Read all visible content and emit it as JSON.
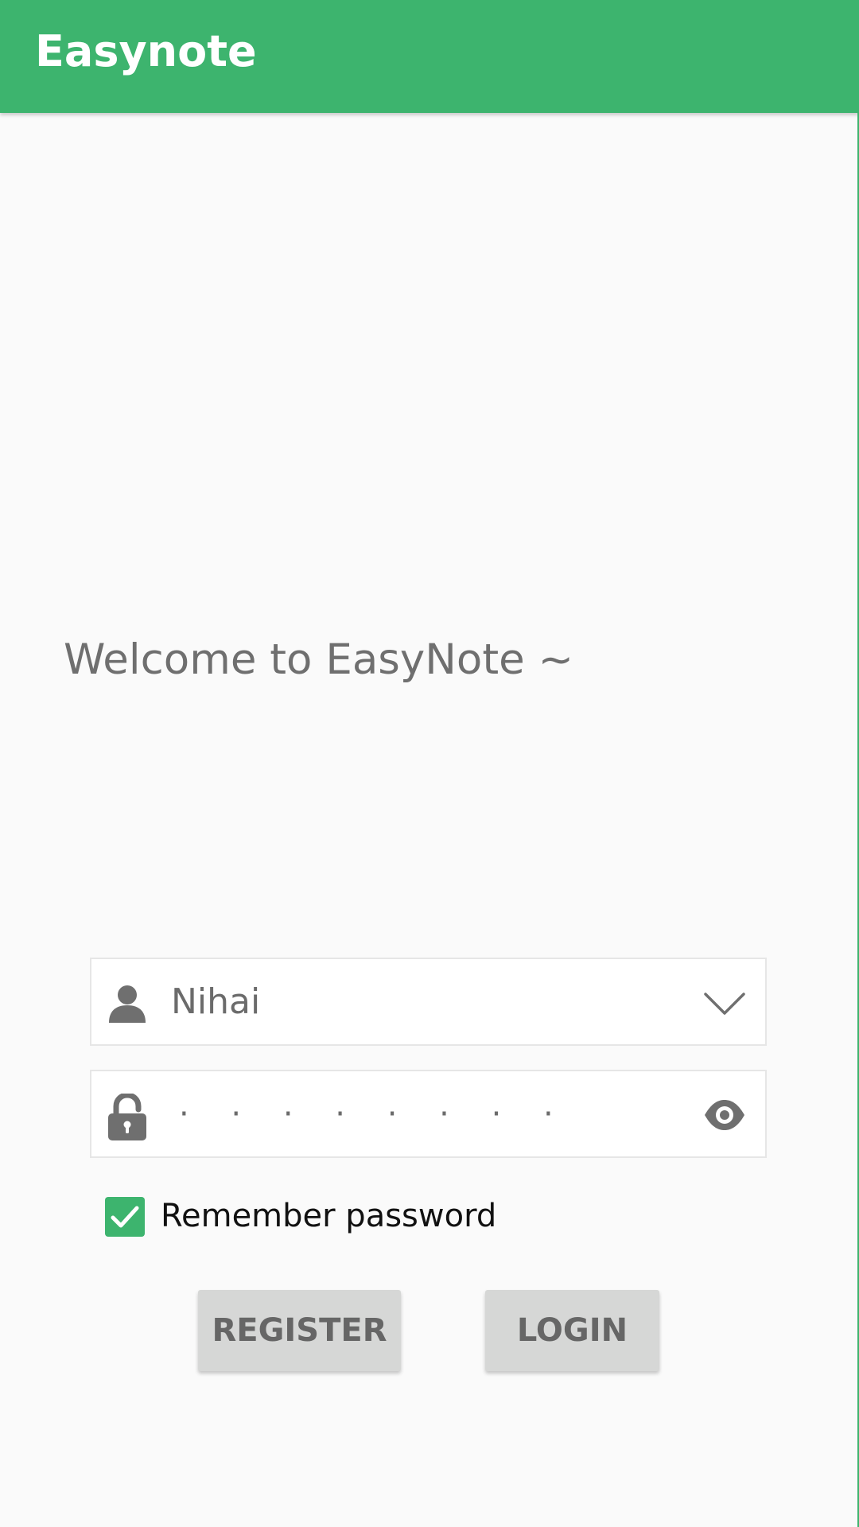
{
  "app_bar": {
    "title": "Easynote"
  },
  "welcome": {
    "text": "Welcome to EasyNote ~"
  },
  "login_form": {
    "username": {
      "value": "Nihai",
      "leading_icon": "person-icon",
      "trailing_icon": "chevron-down-icon"
    },
    "password": {
      "masked_value": "· · · · · · · ·",
      "leading_icon": "lock-icon",
      "trailing_icon": "eye-icon"
    },
    "remember": {
      "label": "Remember password",
      "checked": true
    },
    "buttons": {
      "register_label": "REGISTER",
      "login_label": "LOGIN"
    }
  },
  "colors": {
    "accent": "#3db46e",
    "background": "#fafafa",
    "button": "#d6d7d6",
    "icon": "#6f6f6f"
  }
}
